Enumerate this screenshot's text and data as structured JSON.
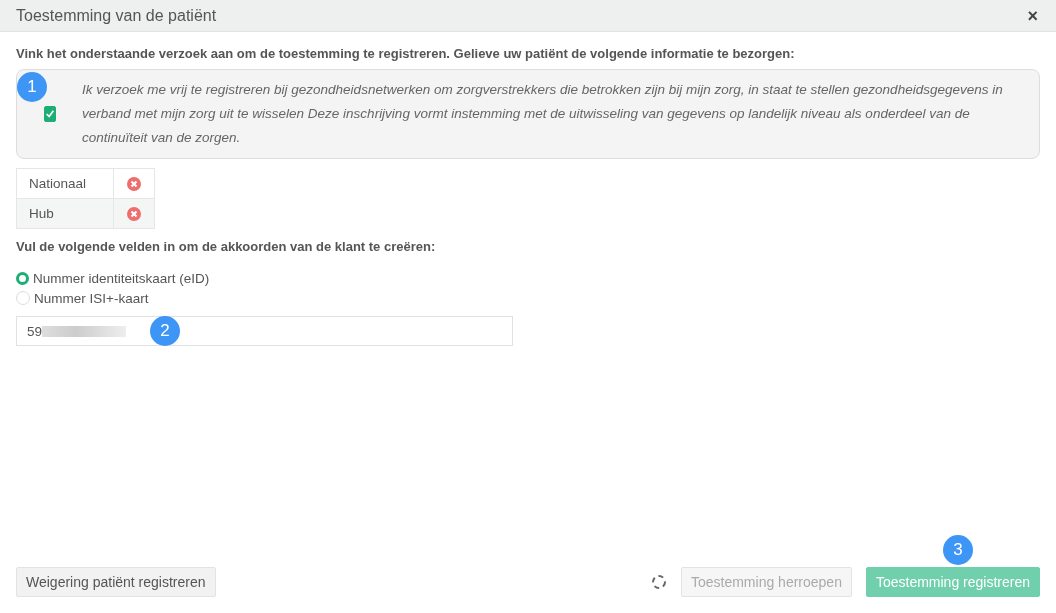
{
  "window": {
    "title": "Toestemming van de patiënt",
    "close": "×"
  },
  "instruction": "Vink het onderstaande verzoek aan om de toestemming te registreren. Gelieve uw patiënt de volgende informatie te bezorgen:",
  "consent": {
    "checked": true,
    "text": "Ik verzoek me vrij te registreren bij gezondheidsnetwerken om zorgverstrekkers die betrokken zijn bij mijn zorg, in staat te stellen gezondheidsgegevens in verband met mijn zorg uit te wisselen Deze inschrijving vormt instemming met de uitwisseling van gegevens op landelijk niveau als onderdeel van de continuïteit van de zorgen."
  },
  "networks": [
    {
      "name": "Nationaal",
      "connected": false
    },
    {
      "name": "Hub",
      "connected": false
    }
  ],
  "fields_heading": "Vul de volgende velden in om de akkoorden van de klant te creëren:",
  "id_types": [
    {
      "label": "Nummer identiteitskaart (eID)",
      "selected": true
    },
    {
      "label": "Nummer ISI+-kaart",
      "selected": false
    }
  ],
  "id_field": {
    "value": "59",
    "redacted": true
  },
  "buttons": [
    {
      "label": "Weigering patiënt registreren",
      "kind": "secondary",
      "disabled": false
    },
    {
      "label": "Toestemming herroepen",
      "kind": "secondary",
      "disabled": true
    },
    {
      "label": "Toestemming registreren",
      "kind": "primary",
      "disabled": true
    }
  ],
  "loading": true,
  "annotations": [
    "1",
    "2",
    "3"
  ]
}
